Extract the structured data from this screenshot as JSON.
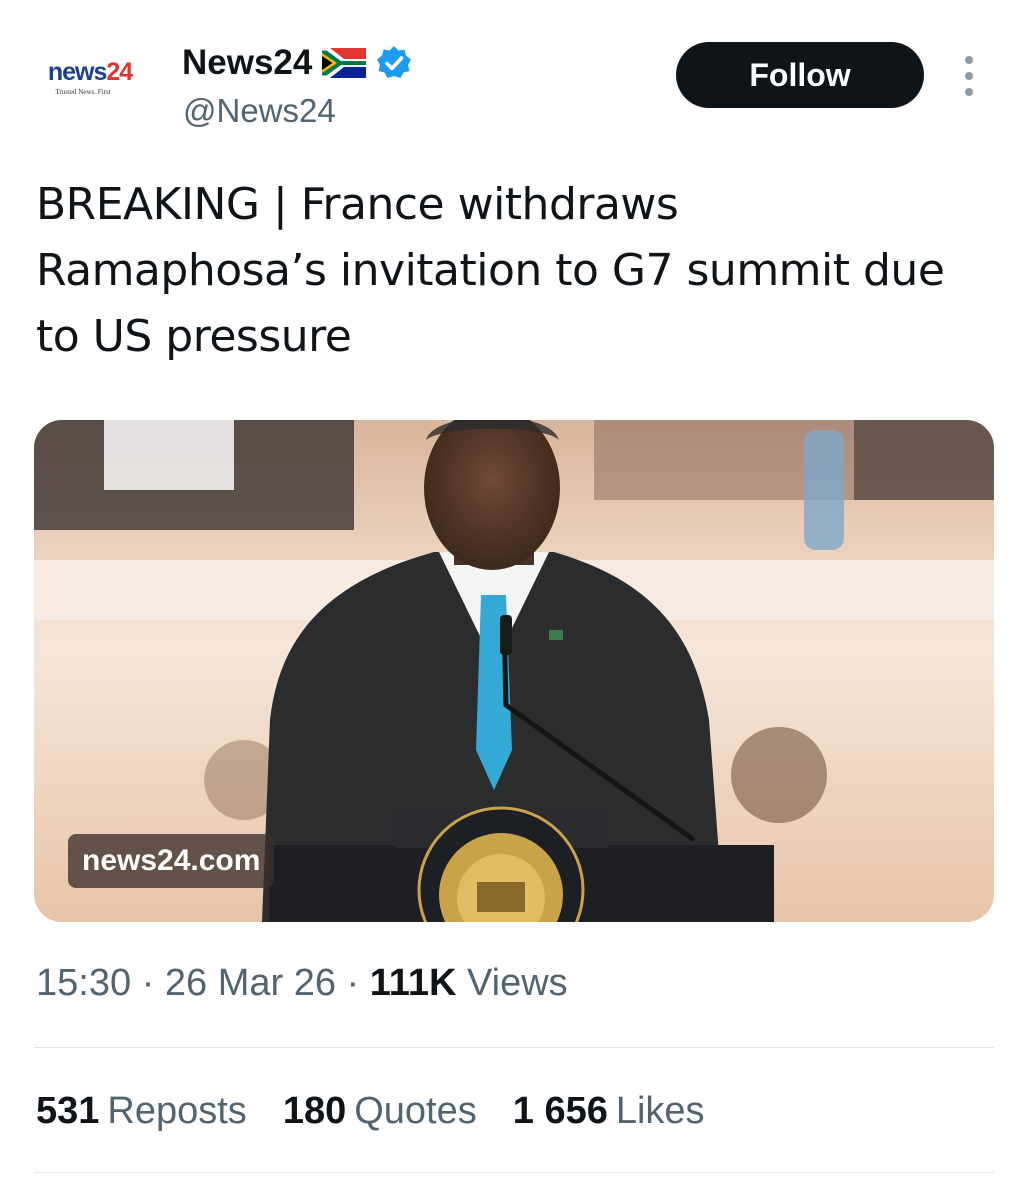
{
  "author": {
    "avatar_word_part1": "news",
    "avatar_word_part2": "24",
    "avatar_tagline": "Trusted News. First",
    "display_name": "News24",
    "flag_icon": "south-africa-flag-icon",
    "verified_icon": "verified-badge-icon",
    "handle": "@News24"
  },
  "actions": {
    "follow_label": "Follow",
    "more_icon": "more-options-icon"
  },
  "tweet": {
    "text": "BREAKING | France withdraws Ramaphosa’s invitation to G7 summit due to US pressure"
  },
  "media": {
    "source_label": "news24.com"
  },
  "meta": {
    "time": "15:30",
    "separator": "·",
    "date": "26 Mar 26",
    "views_count": "111K",
    "views_label": "Views"
  },
  "stats": {
    "reposts_count": "531",
    "reposts_label": "Reposts",
    "quotes_count": "180",
    "quotes_label": "Quotes",
    "likes_count": "1 656",
    "likes_label": "Likes"
  },
  "colors": {
    "text_primary": "#0f1419",
    "text_secondary": "#536471",
    "verified_blue": "#1d9bf0",
    "brand_blue": "#1d3f8f",
    "brand_red": "#e0322e"
  }
}
